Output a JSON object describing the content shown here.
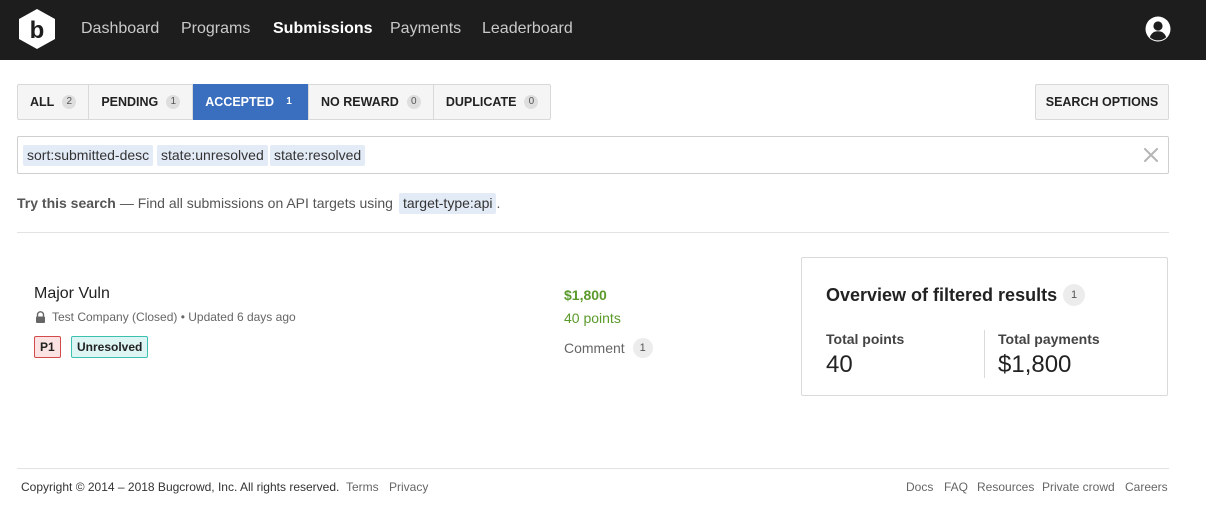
{
  "nav": {
    "items": [
      "Dashboard",
      "Programs",
      "Submissions",
      "Payments",
      "Leaderboard"
    ],
    "active": "Submissions",
    "logo_icon": "bugcrowd-logo-icon",
    "user_icon": "user-avatar-icon"
  },
  "tabs": [
    {
      "label": "ALL",
      "count": "2"
    },
    {
      "label": "PENDING",
      "count": "1"
    },
    {
      "label": "ACCEPTED",
      "count": "1"
    },
    {
      "label": "NO REWARD",
      "count": "0"
    },
    {
      "label": "DUPLICATE",
      "count": "0"
    }
  ],
  "active_tab": "ACCEPTED",
  "search_options_label": "SEARCH OPTIONS",
  "search": {
    "chips": [
      "sort:submitted-desc",
      "state:unresolved",
      "state:resolved"
    ]
  },
  "try_search": {
    "lead": "Try this search",
    "text": "— Find all submissions on API targets using",
    "chip": "target-type:api",
    "end": "."
  },
  "submission": {
    "title": "Major Vuln",
    "meta": "Test Company (Closed) • Updated 6 days ago",
    "priority": "P1",
    "state": "Unresolved",
    "amount": "$1,800",
    "points": "40 points",
    "comment_label": "Comment",
    "comment_count": "1"
  },
  "overview": {
    "title": "Overview of filtered results",
    "count": "1",
    "points_label": "Total points",
    "points_value": "40",
    "payments_label": "Total payments",
    "payments_value": "$1,800"
  },
  "footer": {
    "copyright": "Copyright © 2014 – 2018 Bugcrowd, Inc. All rights reserved.",
    "left_links": [
      "Terms",
      "Privacy"
    ],
    "right_links": [
      "Docs",
      "FAQ",
      "Resources",
      "Private crowd",
      "Careers"
    ]
  },
  "colors": {
    "nav_bg": "#1d1d1d",
    "accent": "#3a6fbf",
    "money": "#5a9a2a",
    "chip_bg": "#e3ebf7"
  }
}
